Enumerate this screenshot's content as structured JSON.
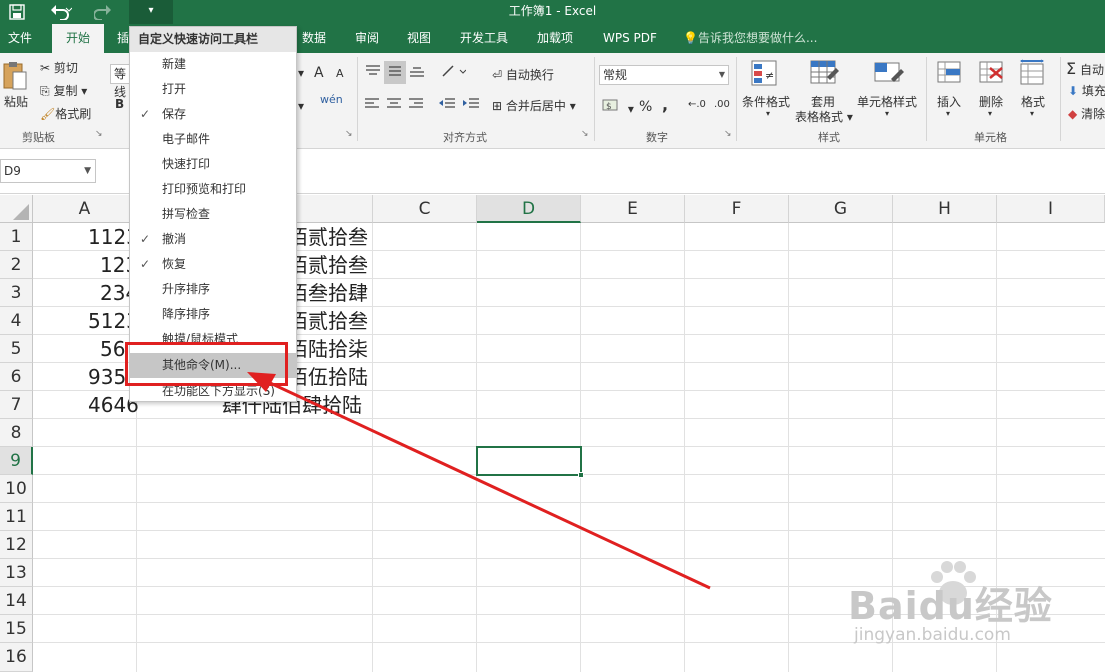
{
  "window": {
    "title": "工作簿1 - Excel"
  },
  "qat": {
    "save_icon": "save-icon",
    "undo_icon": "undo-icon",
    "redo_icon": "redo-icon",
    "dropdown_icon": "chevron-down-icon"
  },
  "tabs": [
    "文件",
    "开始",
    "插",
    "数据",
    "审阅",
    "视图",
    "开发工具",
    "加载项",
    "WPS PDF"
  ],
  "tell_me": "告诉我您想要做什么...",
  "ribbon": {
    "paste": "粘贴",
    "cut": "剪切",
    "copy": "复制",
    "format_painter": "格式刷",
    "clipboard_group": "剪贴板",
    "font_name": "等线",
    "bold": "B",
    "font_grow": "A",
    "font_shrink": "A",
    "phonetic": "wén",
    "wrap_text": "自动换行",
    "merge_center": "合并后居中",
    "alignment_group": "对齐方式",
    "number_format": "常规",
    "percent": "%",
    "comma": ",",
    "dec_inc": "←.0",
    "dec_dec": ".00",
    "number_group": "数字",
    "conditional_format": "条件格式",
    "format_table_1": "套用",
    "format_table_2": "表格格式",
    "cell_styles": "单元格样式",
    "styles_group": "样式",
    "insert": "插入",
    "delete": "删除",
    "format": "格式",
    "cells_group": "单元格",
    "autosum": "自动",
    "fill": "填充",
    "clear": "清除"
  },
  "name_box": "D9",
  "columns": [
    "A",
    "B",
    "C",
    "D",
    "E",
    "F",
    "G",
    "H",
    "I"
  ],
  "selected_column": "D",
  "rows": [
    "1",
    "2",
    "3",
    "4",
    "5",
    "6",
    "7",
    "8",
    "9",
    "10",
    "11",
    "12",
    "13",
    "14",
    "15",
    "16"
  ],
  "selected_row": "9",
  "cells_a": [
    "1123",
    "123",
    "234",
    "5123",
    "56",
    "935",
    "4646"
  ],
  "cells_b": [
    "佰贰拾叁",
    "佰贰拾叁",
    "佰叁拾肆",
    "佰贰拾叁",
    "佰陆拾柒",
    "佰伍拾陆",
    "肆仟陆佰肆拾陆"
  ],
  "menu": {
    "header": "自定义快速访问工具栏",
    "items": [
      {
        "label": "新建",
        "checked": false
      },
      {
        "label": "打开",
        "checked": false
      },
      {
        "label": "保存",
        "checked": true
      },
      {
        "label": "电子邮件",
        "checked": false
      },
      {
        "label": "快速打印",
        "checked": false
      },
      {
        "label": "打印预览和打印",
        "checked": false
      },
      {
        "label": "拼写检查",
        "checked": false
      },
      {
        "label": "撤消",
        "checked": true
      },
      {
        "label": "恢复",
        "checked": true
      },
      {
        "label": "升序排序",
        "checked": false
      },
      {
        "label": "降序排序",
        "checked": false
      },
      {
        "label": "触摸/鼠标模式",
        "checked": false
      },
      {
        "label": "其他命令(M)...",
        "checked": false
      },
      {
        "label": "在功能区下方显示(S)",
        "checked": false
      }
    ]
  },
  "checkmark": "✓",
  "watermark": {
    "main": "Baidu经验",
    "sub": "jingyan.baidu.com"
  },
  "colors": {
    "excel_green": "#217346",
    "annotation_red": "#e02020"
  }
}
